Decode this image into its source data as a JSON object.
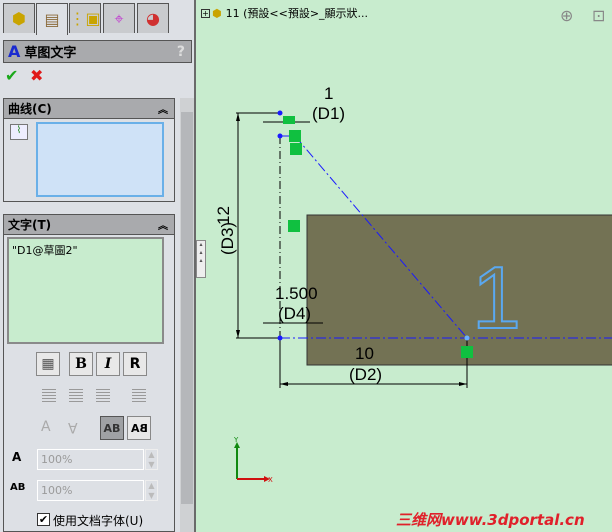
{
  "panel": {
    "tabs": [
      "feature-manager",
      "property-manager",
      "configuration-manager",
      "dimxpert-manager",
      "display-manager"
    ],
    "title": "草图文字",
    "help": "?",
    "ok": "✔",
    "cancel": "✖",
    "curves_section": {
      "label": "曲线(C)"
    },
    "text_section": {
      "label": "文字(T)",
      "value": "\"D1@草圖2\""
    },
    "format_buttons": {
      "bold": "B",
      "italic": "I",
      "rotate": "R"
    },
    "direction": {
      "ltr": "AB",
      "rtl": "BA"
    },
    "width_factor": {
      "value": "100%"
    },
    "spacing": {
      "value": "100%"
    },
    "use_doc_font": {
      "label": "使用文档字体(U)",
      "checked": true
    }
  },
  "canvas": {
    "tree_item": "11  (預設<<預設>_顯示狀...",
    "dimensions": {
      "d1_value": "1",
      "d1_name": "(D1)",
      "d2_value": "10",
      "d2_name": "(D2)",
      "d3_value": "12",
      "d3_name": "(D3)",
      "d4_value": "1.500",
      "d4_name": "(D4)"
    },
    "sketch_text": "1",
    "axes": {
      "x": "X",
      "y": "Y"
    },
    "watermark": "三维网www.3dportal.cn"
  },
  "colors": {
    "canvas": "#c8ecce",
    "part": "#737254",
    "sketch": "#1a1aff",
    "watermark": "#e0202a"
  }
}
